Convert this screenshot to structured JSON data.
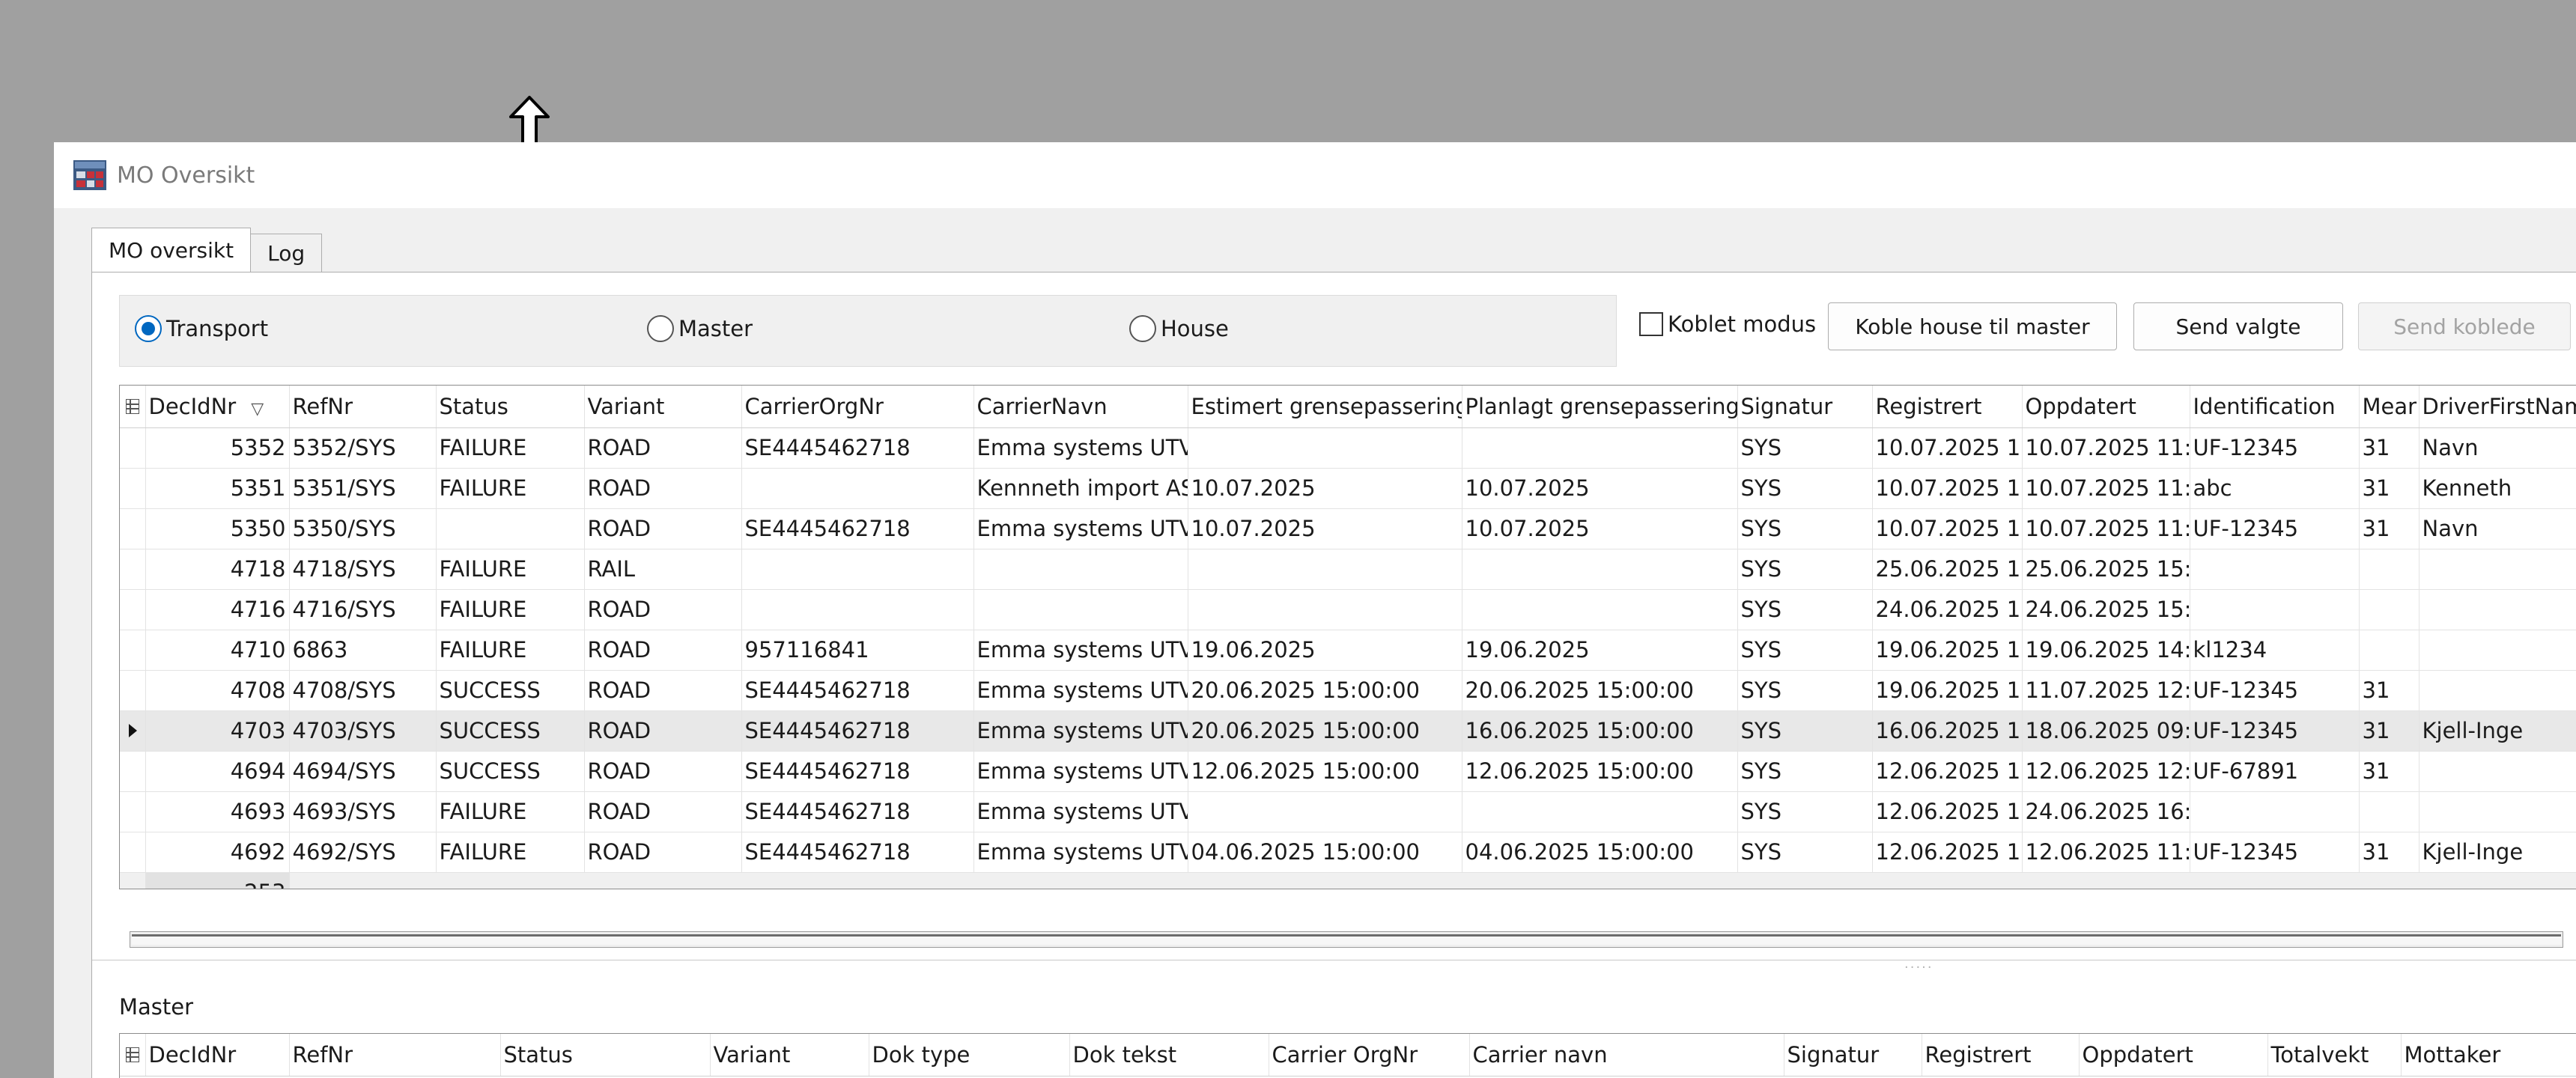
{
  "window": {
    "title": "MO Oversikt"
  },
  "tabs": [
    {
      "label": "MO oversikt",
      "active": true
    },
    {
      "label": "Log",
      "active": false
    }
  ],
  "mode": {
    "options": [
      {
        "label": "Transport",
        "selected": true
      },
      {
        "label": "Master",
        "selected": false
      },
      {
        "label": "House",
        "selected": false
      }
    ]
  },
  "toolbar": {
    "koblet_modus_label": "Koblet modus",
    "koblet_modus_checked": false,
    "koble_button": "Koble house til master",
    "send_valgte_button": "Send valgte",
    "send_koblede_button": "Send koblede"
  },
  "transport_grid": {
    "columns": [
      "DecIdNr",
      "RefNr",
      "Status",
      "Variant",
      "CarrierOrgNr",
      "CarrierNavn",
      "Estimert grensepassering",
      "Planlagt grensepassering",
      "Signatur",
      "Registrert",
      "Oppdatert",
      "Identification",
      "Mear",
      "DriverFirstNam"
    ],
    "rows": [
      [
        "5352",
        "5352/SYS",
        "FAILURE",
        "ROAD",
        "SE4445462718",
        "Emma systems UTVI",
        "",
        "",
        "SYS",
        "10.07.2025 1",
        "10.07.2025 11:",
        "UF-12345",
        "31",
        "Navn"
      ],
      [
        "5351",
        "5351/SYS",
        "FAILURE",
        "ROAD",
        "",
        "Kennneth import AS",
        "10.07.2025",
        "10.07.2025",
        "SYS",
        "10.07.2025 1",
        "10.07.2025 11:",
        "abc",
        "31",
        "Kenneth"
      ],
      [
        "5350",
        "5350/SYS",
        "",
        "ROAD",
        "SE4445462718",
        "Emma systems UTVI",
        "10.07.2025",
        "10.07.2025",
        "SYS",
        "10.07.2025 1",
        "10.07.2025 11:",
        "UF-12345",
        "31",
        "Navn"
      ],
      [
        "4718",
        "4718/SYS",
        "FAILURE",
        "RAIL",
        "",
        "",
        "",
        "",
        "SYS",
        "25.06.2025 1",
        "25.06.2025 15:",
        "",
        "",
        ""
      ],
      [
        "4716",
        "4716/SYS",
        "FAILURE",
        "ROAD",
        "",
        "",
        "",
        "",
        "SYS",
        "24.06.2025 1",
        "24.06.2025 15:",
        "",
        "",
        ""
      ],
      [
        "4710",
        "6863",
        "FAILURE",
        "ROAD",
        "957116841",
        "Emma systems UTVI",
        "19.06.2025",
        "19.06.2025",
        "SYS",
        "19.06.2025 1",
        "19.06.2025 14:",
        "kl1234",
        "",
        ""
      ],
      [
        "4708",
        "4708/SYS",
        "SUCCESS",
        "ROAD",
        "SE4445462718",
        "Emma systems UTVI",
        "20.06.2025 15:00:00",
        "20.06.2025 15:00:00",
        "SYS",
        "19.06.2025 1",
        "11.07.2025 12:",
        "UF-12345",
        "31",
        ""
      ],
      [
        "4703",
        "4703/SYS",
        "SUCCESS",
        "ROAD",
        "SE4445462718",
        "Emma systems UTVI",
        "20.06.2025 15:00:00",
        "16.06.2025 15:00:00",
        "SYS",
        "16.06.2025 1",
        "18.06.2025 09:",
        "UF-12345",
        "31",
        "Kjell-Inge"
      ],
      [
        "4694",
        "4694/SYS",
        "SUCCESS",
        "ROAD",
        "SE4445462718",
        "Emma systems UTVI",
        "12.06.2025 15:00:00",
        "12.06.2025 15:00:00",
        "SYS",
        "12.06.2025 1",
        "12.06.2025 12:",
        "UF-67891",
        "31",
        ""
      ],
      [
        "4693",
        "4693/SYS",
        "FAILURE",
        "ROAD",
        "SE4445462718",
        "Emma systems UTVI",
        "",
        "",
        "SYS",
        "12.06.2025 1",
        "24.06.2025 16:",
        "",
        "",
        ""
      ],
      [
        "4692",
        "4692/SYS",
        "FAILURE",
        "ROAD",
        "SE4445462718",
        "Emma systems UTVI",
        "04.06.2025 15:00:00",
        "04.06.2025 15:00:00",
        "SYS",
        "12.06.2025 1",
        "12.06.2025 11:",
        "UF-12345",
        "31",
        "Kjell-Inge"
      ]
    ],
    "selected_row": 7,
    "footer_count": "253"
  },
  "master_section": {
    "label": "Master",
    "columns": [
      "DecIdNr",
      "RefNr",
      "Status",
      "Variant",
      "Dok type",
      "Dok tekst",
      "Carrier OrgNr",
      "Carrier navn",
      "Signatur",
      "Registrert",
      "Oppdatert",
      "Totalvekt",
      "Mottaker"
    ]
  }
}
